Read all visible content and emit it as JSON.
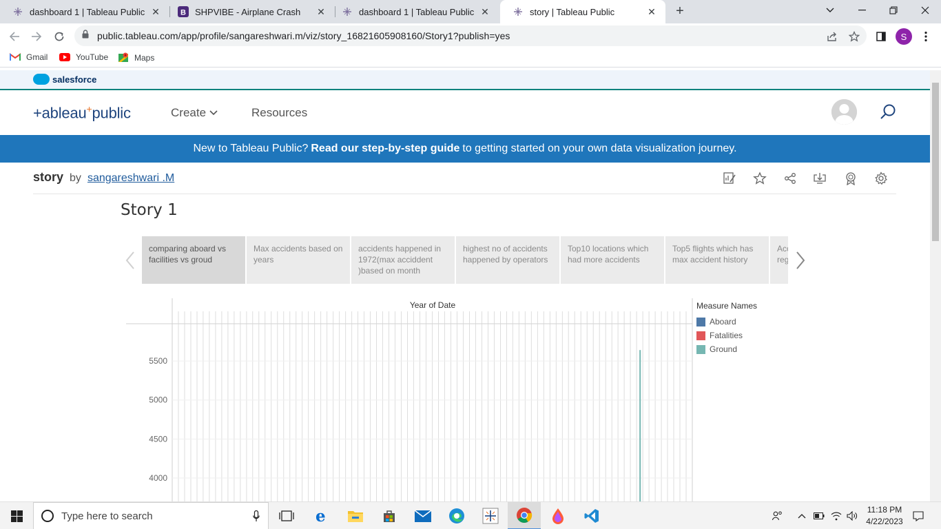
{
  "browser": {
    "tabs": [
      {
        "title": "dashboard 1 | Tableau Public",
        "icon": "tableau-icon",
        "active": false
      },
      {
        "title": "SHPVIBE - Airplane Crash",
        "icon": "b-icon",
        "active": false
      },
      {
        "title": "dashboard 1 | Tableau Public",
        "icon": "tableau-icon",
        "active": false
      },
      {
        "title": "story | Tableau Public",
        "icon": "tableau-icon",
        "active": true
      }
    ],
    "url": "public.tableau.com/app/profile/sangareshwari.m/viz/story_16821605908160/Story1?publish=yes",
    "profile_initial": "S",
    "bookmarks": [
      {
        "label": "Gmail",
        "icon": "gmail-icon"
      },
      {
        "label": "YouTube",
        "icon": "youtube-icon"
      },
      {
        "label": "Maps",
        "icon": "maps-icon"
      }
    ]
  },
  "salesforce": {
    "label": "salesforce"
  },
  "header": {
    "logo": "+ableau",
    "logo_suffix": "public",
    "nav": {
      "create": "Create",
      "resources": "Resources"
    }
  },
  "banner": {
    "prefix": "New to Tableau Public?",
    "link": "Read our step-by-step guide",
    "suffix": "to getting started on your own data visualization journey."
  },
  "viz": {
    "name": "story",
    "by": "by",
    "author": "sangareshwari .M"
  },
  "story": {
    "title": "Story 1",
    "points": [
      "comparing aboard vs facilities vs groud",
      "Max accidents based on years",
      "accidents happened in 1972(max acciddent )based on month",
      "highest no of accidents happened by operators",
      "Top10 locations which had more accidents",
      "Top5 flights which has max accident history",
      "Acc reg"
    ]
  },
  "chart_data": {
    "type": "bar",
    "title": "Year of Date",
    "y_ticks": [
      5500,
      5000,
      4500,
      4000
    ],
    "ylim": [
      3700,
      5960
    ],
    "legend_title": "Measure Names",
    "series": [
      {
        "name": "Aboard",
        "color": "#4e79a7"
      },
      {
        "name": "Fatalities",
        "color": "#e15759"
      },
      {
        "name": "Ground",
        "color": "#76b7b2",
        "peak_value": 5640
      }
    ],
    "grid": true,
    "legend_position": "right"
  },
  "taskbar": {
    "search_placeholder": "Type here to search",
    "time": "11:18 PM",
    "date": "4/22/2023"
  }
}
